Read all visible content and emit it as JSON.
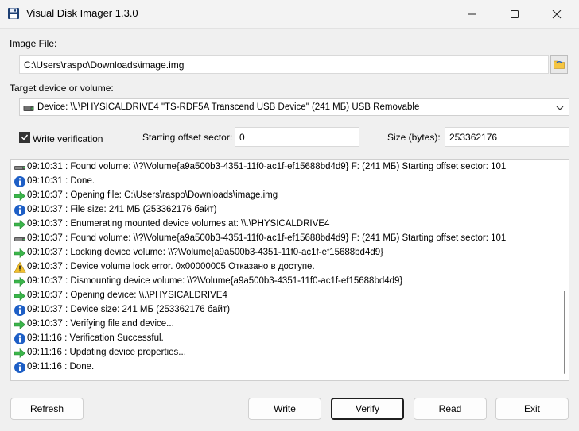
{
  "window": {
    "title": "Visual Disk Imager 1.3.0"
  },
  "image_file": {
    "label": "Image File:",
    "value": "C:\\Users\\raspo\\Downloads\\image.img"
  },
  "target": {
    "label": "Target device or volume:",
    "value": "Device: \\\\.\\PHYSICALDRIVE4 \"TS-RDF5A Transcend USB Device\" (241 МБ) USB Removable"
  },
  "options": {
    "verify_label": "Write verification",
    "verify_checked": true,
    "offset_label": "Starting offset sector:",
    "offset_value": "0",
    "size_label": "Size (bytes):",
    "size_value": "253362176"
  },
  "log": [
    {
      "icon": "drive",
      "text": "09:10:31 : Found volume: \\\\?\\Volume{a9a500b3-4351-11f0-ac1f-ef15688bd4d9} F: (241 МБ) Starting offset sector: 101"
    },
    {
      "icon": "info",
      "text": "09:10:31 : Done."
    },
    {
      "icon": "arrow",
      "text": "09:10:37 : Opening file: C:\\Users\\raspo\\Downloads\\image.img"
    },
    {
      "icon": "info",
      "text": "09:10:37 : File size: 241 МБ (253362176 байт)"
    },
    {
      "icon": "arrow",
      "text": "09:10:37 : Enumerating mounted device volumes at: \\\\.\\PHYSICALDRIVE4"
    },
    {
      "icon": "drive",
      "text": "09:10:37 : Found volume: \\\\?\\Volume{a9a500b3-4351-11f0-ac1f-ef15688bd4d9} F: (241 МБ) Starting offset sector: 101"
    },
    {
      "icon": "arrow",
      "text": "09:10:37 : Locking device volume: \\\\?\\Volume{a9a500b3-4351-11f0-ac1f-ef15688bd4d9}"
    },
    {
      "icon": "warning",
      "text": "09:10:37 : Device volume lock error. 0x00000005 Отказано в доступе."
    },
    {
      "icon": "arrow",
      "text": "09:10:37 : Dismounting device volume: \\\\?\\Volume{a9a500b3-4351-11f0-ac1f-ef15688bd4d9}"
    },
    {
      "icon": "arrow",
      "text": "09:10:37 : Opening device: \\\\.\\PHYSICALDRIVE4"
    },
    {
      "icon": "info",
      "text": "09:10:37 : Device size: 241 МБ (253362176 байт)"
    },
    {
      "icon": "arrow",
      "text": "09:10:37 : Verifying file and device..."
    },
    {
      "icon": "info",
      "text": "09:11:16 : Verification Successful."
    },
    {
      "icon": "arrow",
      "text": "09:11:16 : Updating device properties..."
    },
    {
      "icon": "info",
      "text": "09:11:16 : Done."
    }
  ],
  "buttons": {
    "refresh": "Refresh",
    "write": "Write",
    "verify": "Verify",
    "read": "Read",
    "exit": "Exit"
  },
  "colors": {
    "info": "#1e5fc6",
    "arrow": "#3bb54a",
    "warning": "#f2c12e",
    "accent": "#0067c0"
  }
}
